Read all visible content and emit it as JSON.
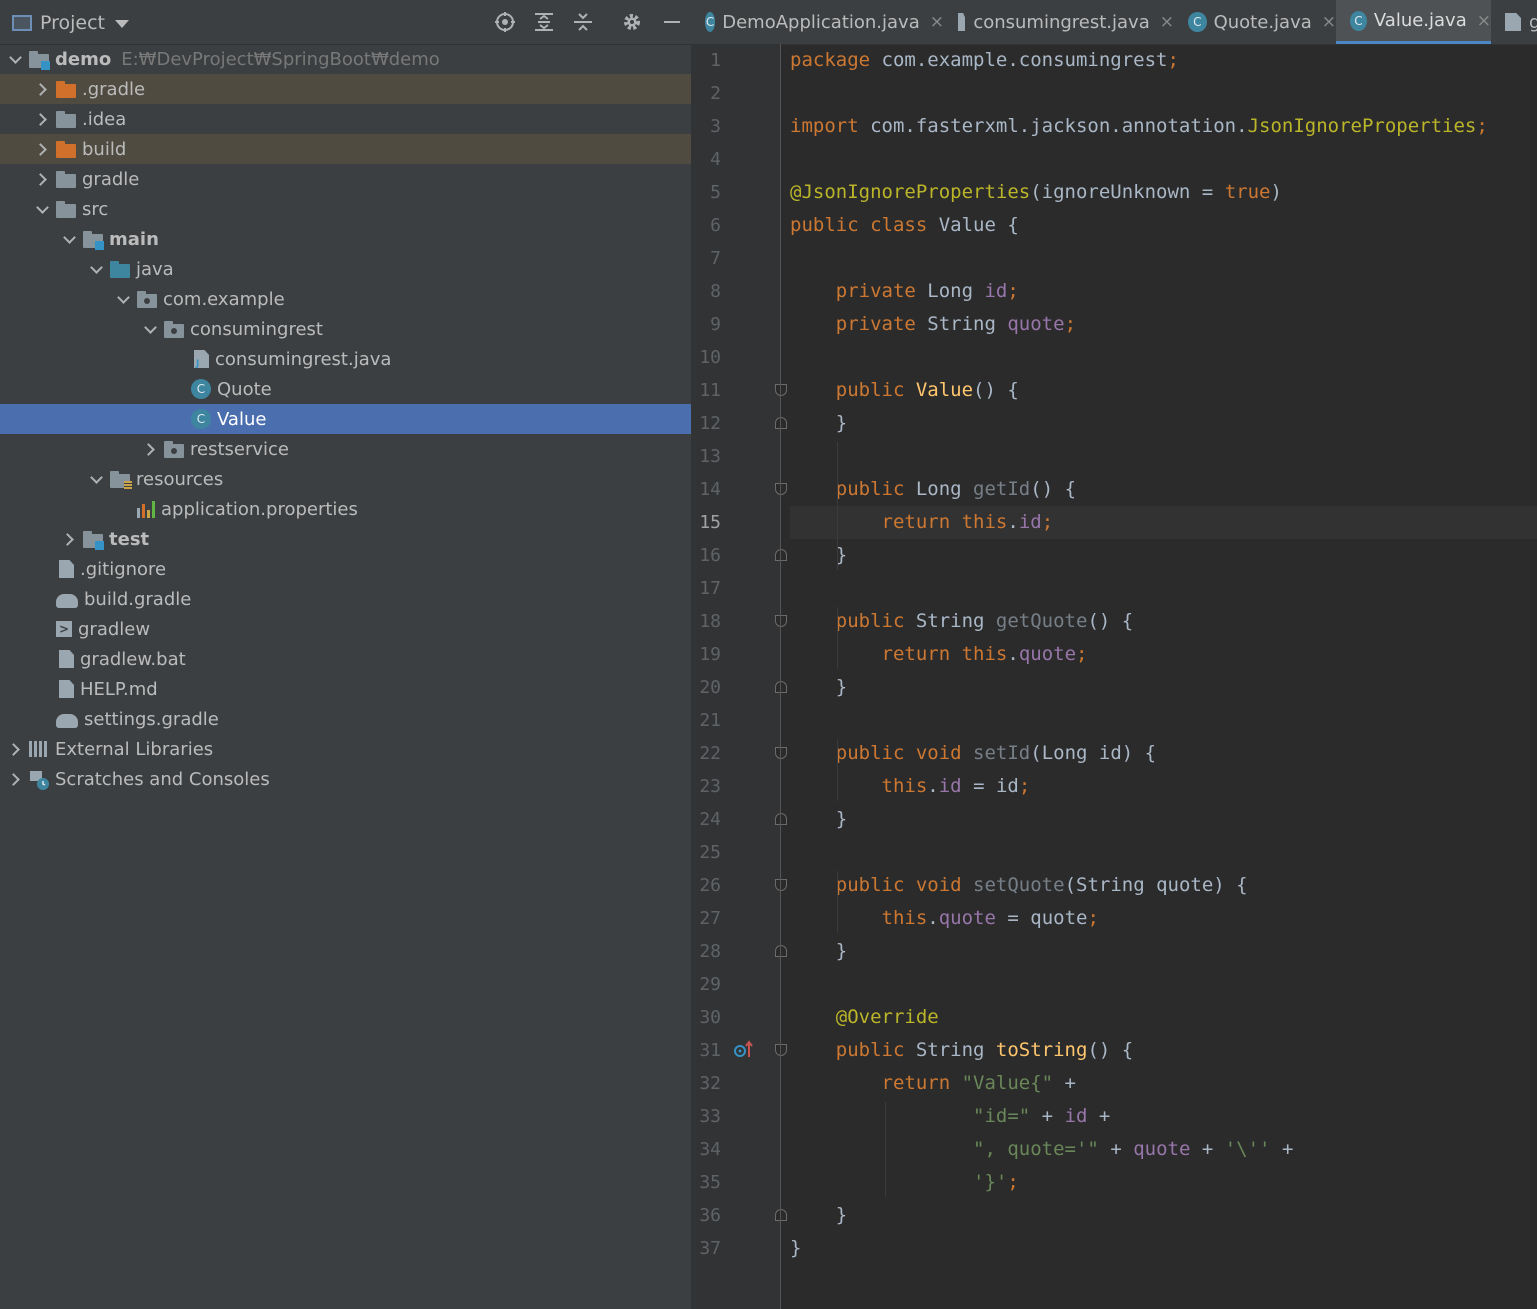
{
  "panel": {
    "title": "Project",
    "header_icons": [
      "locate-icon",
      "expand-all-icon",
      "collapse-all-icon",
      "gear-icon",
      "minimize-icon"
    ]
  },
  "tree": [
    {
      "depth": 0,
      "expanded": true,
      "icon": "module-folder-icon",
      "label": "demo",
      "bold": true,
      "hint": "E:₩DevProject₩SpringBoot₩demo",
      "state": "normal"
    },
    {
      "depth": 1,
      "expanded": false,
      "icon": "folder-orange-icon",
      "label": ".gradle",
      "state": "excluded"
    },
    {
      "depth": 1,
      "expanded": false,
      "icon": "folder-icon",
      "label": ".idea",
      "state": "normal"
    },
    {
      "depth": 1,
      "expanded": false,
      "icon": "folder-orange-icon",
      "label": "build",
      "state": "excluded"
    },
    {
      "depth": 1,
      "expanded": false,
      "icon": "folder-icon",
      "label": "gradle",
      "state": "normal"
    },
    {
      "depth": 1,
      "expanded": true,
      "icon": "folder-icon",
      "label": "src",
      "state": "normal"
    },
    {
      "depth": 2,
      "expanded": true,
      "icon": "module-folder-icon",
      "label": "main",
      "bold": true,
      "state": "normal"
    },
    {
      "depth": 3,
      "expanded": true,
      "icon": "source-folder-icon",
      "label": "java",
      "state": "normal"
    },
    {
      "depth": 4,
      "expanded": true,
      "icon": "package-icon",
      "label": "com.example",
      "state": "normal"
    },
    {
      "depth": 5,
      "expanded": true,
      "icon": "package-icon",
      "label": "consumingrest",
      "state": "normal"
    },
    {
      "depth": 6,
      "leaf": true,
      "icon": "java-file-icon",
      "label": "consumingrest.java",
      "state": "normal"
    },
    {
      "depth": 6,
      "leaf": true,
      "icon": "class-icon",
      "label": "Quote",
      "state": "normal"
    },
    {
      "depth": 6,
      "leaf": true,
      "icon": "class-icon",
      "label": "Value",
      "state": "selected"
    },
    {
      "depth": 5,
      "expanded": false,
      "icon": "package-icon",
      "label": "restservice",
      "state": "normal"
    },
    {
      "depth": 3,
      "expanded": true,
      "icon": "resources-folder-icon",
      "label": "resources",
      "state": "normal"
    },
    {
      "depth": 4,
      "leaf": true,
      "icon": "properties-file-icon",
      "label": "application.properties",
      "state": "normal"
    },
    {
      "depth": 2,
      "expanded": false,
      "icon": "module-folder-icon",
      "label": "test",
      "bold": true,
      "state": "normal"
    },
    {
      "depth": 1,
      "leaf": true,
      "icon": "gitignore-file-icon",
      "label": ".gitignore",
      "state": "normal"
    },
    {
      "depth": 1,
      "leaf": true,
      "icon": "gradle-icon",
      "label": "build.gradle",
      "state": "normal"
    },
    {
      "depth": 1,
      "leaf": true,
      "icon": "terminal-file-icon",
      "label": "gradlew",
      "state": "normal"
    },
    {
      "depth": 1,
      "leaf": true,
      "icon": "text-file-icon",
      "label": "gradlew.bat",
      "state": "normal"
    },
    {
      "depth": 1,
      "leaf": true,
      "icon": "markdown-file-icon",
      "label": "HELP.md",
      "state": "normal"
    },
    {
      "depth": 1,
      "leaf": true,
      "icon": "gradle-icon",
      "label": "settings.gradle",
      "state": "normal"
    },
    {
      "depth": 0,
      "expanded": false,
      "icon": "libraries-icon",
      "label": "External Libraries",
      "state": "normal"
    },
    {
      "depth": 0,
      "expanded": false,
      "icon": "scratches-icon",
      "label": "Scratches and Consoles",
      "state": "normal"
    }
  ],
  "tabs": [
    {
      "label": "DemoApplication.java",
      "icon": "spring-class-icon",
      "active": false
    },
    {
      "label": "consumingrest.java",
      "icon": "java-file-icon",
      "active": false
    },
    {
      "label": "Quote.java",
      "icon": "class-icon",
      "active": false
    },
    {
      "label": "Value.java",
      "icon": "class-icon",
      "active": true
    },
    {
      "label": "g",
      "icon": "file-icon",
      "active": false
    }
  ],
  "editor": {
    "current_line": 15,
    "fold_start_lines": [
      11,
      14,
      18,
      22,
      26,
      31
    ],
    "fold_end_lines": [
      12,
      16,
      20,
      24,
      28,
      36
    ],
    "override_marker_line": 31,
    "lines": [
      [
        [
          "kw",
          "package "
        ],
        [
          "plain",
          "com.example.consumingrest"
        ],
        [
          "kw",
          ";"
        ]
      ],
      [],
      [
        [
          "kw",
          "import "
        ],
        [
          "plain",
          "com.fasterxml.jackson.annotation."
        ],
        [
          "ann",
          "JsonIgnoreProperties"
        ],
        [
          "kw",
          ";"
        ]
      ],
      [],
      [
        [
          "ann",
          "@JsonIgnoreProperties"
        ],
        [
          "plain",
          "(ignoreUnknown = "
        ],
        [
          "kw",
          "true"
        ],
        [
          "plain",
          ")"
        ]
      ],
      [
        [
          "kw",
          "public class "
        ],
        [
          "plain",
          "Value {"
        ]
      ],
      [],
      [
        [
          "plain",
          "    "
        ],
        [
          "kw",
          "private "
        ],
        [
          "plain",
          "Long "
        ],
        [
          "fld",
          "id"
        ],
        [
          "kw",
          ";"
        ]
      ],
      [
        [
          "plain",
          "    "
        ],
        [
          "kw",
          "private "
        ],
        [
          "plain",
          "String "
        ],
        [
          "fld",
          "quote"
        ],
        [
          "kw",
          ";"
        ]
      ],
      [],
      [
        [
          "plain",
          "    "
        ],
        [
          "kw",
          "public "
        ],
        [
          "fn",
          "Value"
        ],
        [
          "plain",
          "() {"
        ]
      ],
      [
        [
          "plain",
          "    }"
        ]
      ],
      [],
      [
        [
          "plain",
          "    "
        ],
        [
          "kw",
          "public "
        ],
        [
          "plain",
          "Long "
        ],
        [
          "fnd",
          "getId"
        ],
        [
          "plain",
          "() {"
        ]
      ],
      [
        [
          "plain",
          "        "
        ],
        [
          "kw",
          "return this"
        ],
        [
          "plain",
          "."
        ],
        [
          "fld",
          "id"
        ],
        [
          "kw",
          ";"
        ]
      ],
      [
        [
          "plain",
          "    }"
        ]
      ],
      [],
      [
        [
          "plain",
          "    "
        ],
        [
          "kw",
          "public "
        ],
        [
          "plain",
          "String "
        ],
        [
          "fnd",
          "getQuote"
        ],
        [
          "plain",
          "() {"
        ]
      ],
      [
        [
          "plain",
          "        "
        ],
        [
          "kw",
          "return this"
        ],
        [
          "plain",
          "."
        ],
        [
          "fld",
          "quote"
        ],
        [
          "kw",
          ";"
        ]
      ],
      [
        [
          "plain",
          "    }"
        ]
      ],
      [],
      [
        [
          "plain",
          "    "
        ],
        [
          "kw",
          "public void "
        ],
        [
          "fnd",
          "setId"
        ],
        [
          "plain",
          "(Long id) {"
        ]
      ],
      [
        [
          "plain",
          "        "
        ],
        [
          "kw",
          "this"
        ],
        [
          "plain",
          "."
        ],
        [
          "fld",
          "id"
        ],
        [
          "plain",
          " = id"
        ],
        [
          "kw",
          ";"
        ]
      ],
      [
        [
          "plain",
          "    }"
        ]
      ],
      [],
      [
        [
          "plain",
          "    "
        ],
        [
          "kw",
          "public void "
        ],
        [
          "fnd",
          "setQuote"
        ],
        [
          "plain",
          "(String quote) {"
        ]
      ],
      [
        [
          "plain",
          "        "
        ],
        [
          "kw",
          "this"
        ],
        [
          "plain",
          "."
        ],
        [
          "fld",
          "quote"
        ],
        [
          "plain",
          " = quote"
        ],
        [
          "kw",
          ";"
        ]
      ],
      [
        [
          "plain",
          "    }"
        ]
      ],
      [],
      [
        [
          "plain",
          "    "
        ],
        [
          "ann",
          "@Override"
        ]
      ],
      [
        [
          "plain",
          "    "
        ],
        [
          "kw",
          "public "
        ],
        [
          "plain",
          "String "
        ],
        [
          "fn",
          "toString"
        ],
        [
          "plain",
          "() {"
        ]
      ],
      [
        [
          "plain",
          "        "
        ],
        [
          "kw",
          "return "
        ],
        [
          "str",
          "\"Value{\""
        ],
        [
          "plain",
          " +"
        ]
      ],
      [
        [
          "plain",
          "                "
        ],
        [
          "str",
          "\"id=\""
        ],
        [
          "plain",
          " + "
        ],
        [
          "fld",
          "id"
        ],
        [
          "plain",
          " +"
        ]
      ],
      [
        [
          "plain",
          "                "
        ],
        [
          "str",
          "\", quote='\""
        ],
        [
          "plain",
          " + "
        ],
        [
          "fld",
          "quote"
        ],
        [
          "plain",
          " + "
        ],
        [
          "str",
          "'\\''"
        ],
        [
          "plain",
          " +"
        ]
      ],
      [
        [
          "plain",
          "                "
        ],
        [
          "str",
          "'}'"
        ],
        [
          "kw",
          ";"
        ]
      ],
      [
        [
          "plain",
          "    }"
        ]
      ],
      [
        [
          "plain",
          "}"
        ]
      ]
    ]
  },
  "colors": {
    "keyword": "#cc7832",
    "annotation": "#bbb529",
    "field": "#9876aa",
    "method": "#ffc66d",
    "string": "#6a8759",
    "text": "#a9b7c6",
    "selection": "#4b6eaf",
    "excluded": "#4f4b41"
  }
}
